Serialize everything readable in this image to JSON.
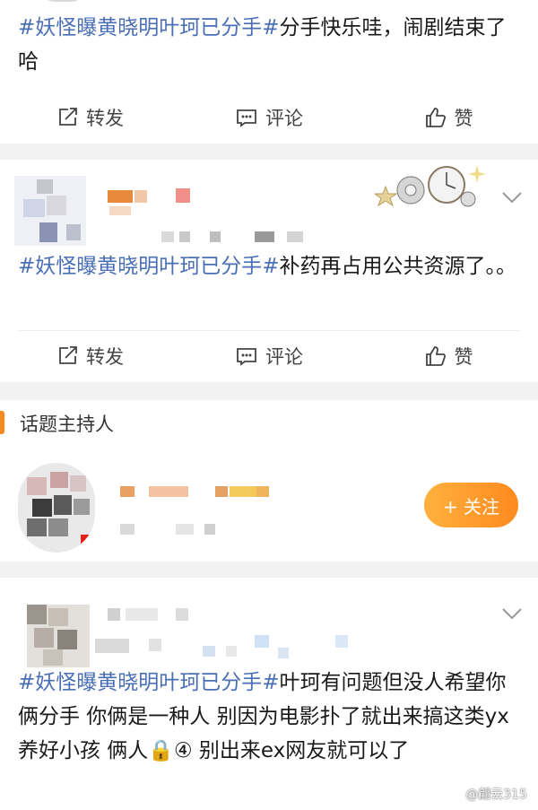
{
  "posts": [
    {
      "text_topic": "#妖怪曝黄晓明叶珂已分手#",
      "text_body": "分手快乐哇，闹剧结束了哈"
    },
    {
      "text_topic": "#妖怪曝黄晓明叶珂已分手#",
      "text_body": "补药再占用公共资源了。。"
    },
    {
      "text_topic": "#妖怪曝黄晓明叶珂已分手#",
      "text_body": "叶珂有问题但没人希望你俩分手 你俩是一种人  别因为电影扑了就出来搞这类yx  养好小孩 俩人🔒④  别出来ex网友就可以了"
    }
  ],
  "actions": {
    "repost": "转发",
    "comment": "评论",
    "like": "赞"
  },
  "host_section": {
    "title": "话题主持人",
    "follow_label": "+ 关注"
  },
  "watermark": "@翩云315",
  "colors": {
    "topic": "#4a6fb5",
    "accent": "#ff8a1f"
  }
}
